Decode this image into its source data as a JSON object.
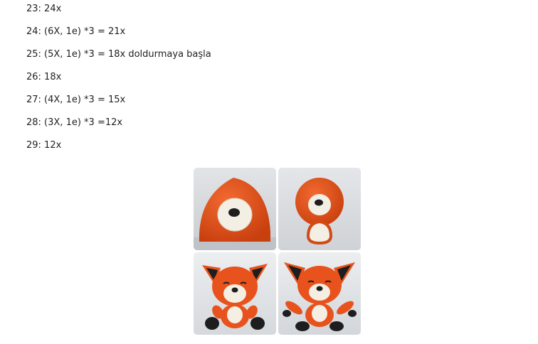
{
  "pattern_rows": [
    "23: 24x",
    "24: (6X, 1e) *3 = 21x",
    "25: (5X, 1e) *3 = 18x doldurmaya başla",
    "26: 18x",
    "27: (4X, 1e) *3 = 15x",
    "28: (3X, 1e) *3 =12x",
    "29: 12x"
  ],
  "colors": {
    "text": "#222222",
    "yarn_orange": "#e8521c",
    "yarn_cream": "#f4efe2",
    "yarn_black": "#1c1c1c",
    "backdrop": "#dcdfe3"
  },
  "collage": {
    "photos": [
      "fox-head-back-photo",
      "fox-head-and-body-photo",
      "fox-assembled-photo-1",
      "fox-assembled-photo-2"
    ]
  }
}
